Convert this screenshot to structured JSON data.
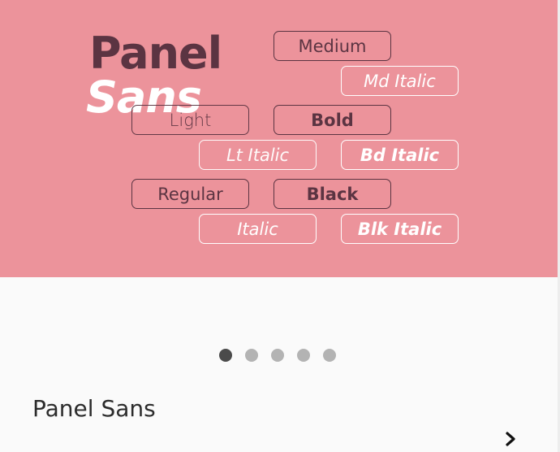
{
  "banner": {
    "logo_line1": "Panel",
    "logo_line2": "Sans",
    "weights": [
      {
        "label": "Medium"
      },
      {
        "label": "Md Italic"
      },
      {
        "label": "Light"
      },
      {
        "label": "Bold"
      },
      {
        "label": "Lt Italic"
      },
      {
        "label": "Bd Italic"
      },
      {
        "label": "Regular"
      },
      {
        "label": "Black"
      },
      {
        "label": "Italic"
      },
      {
        "label": "Blk Italic"
      }
    ]
  },
  "carousel": {
    "page_count": 5,
    "current_page": 1
  },
  "font_title": "Panel Sans",
  "icons": {
    "next": "chevron-right-icon"
  },
  "colors": {
    "banner_bg": "#ec939b",
    "ink_dark": "#5b3442",
    "ink_light": "#ffffff",
    "dot_active": "#4b4b4b",
    "dot_inactive": "#b3b3b3"
  }
}
